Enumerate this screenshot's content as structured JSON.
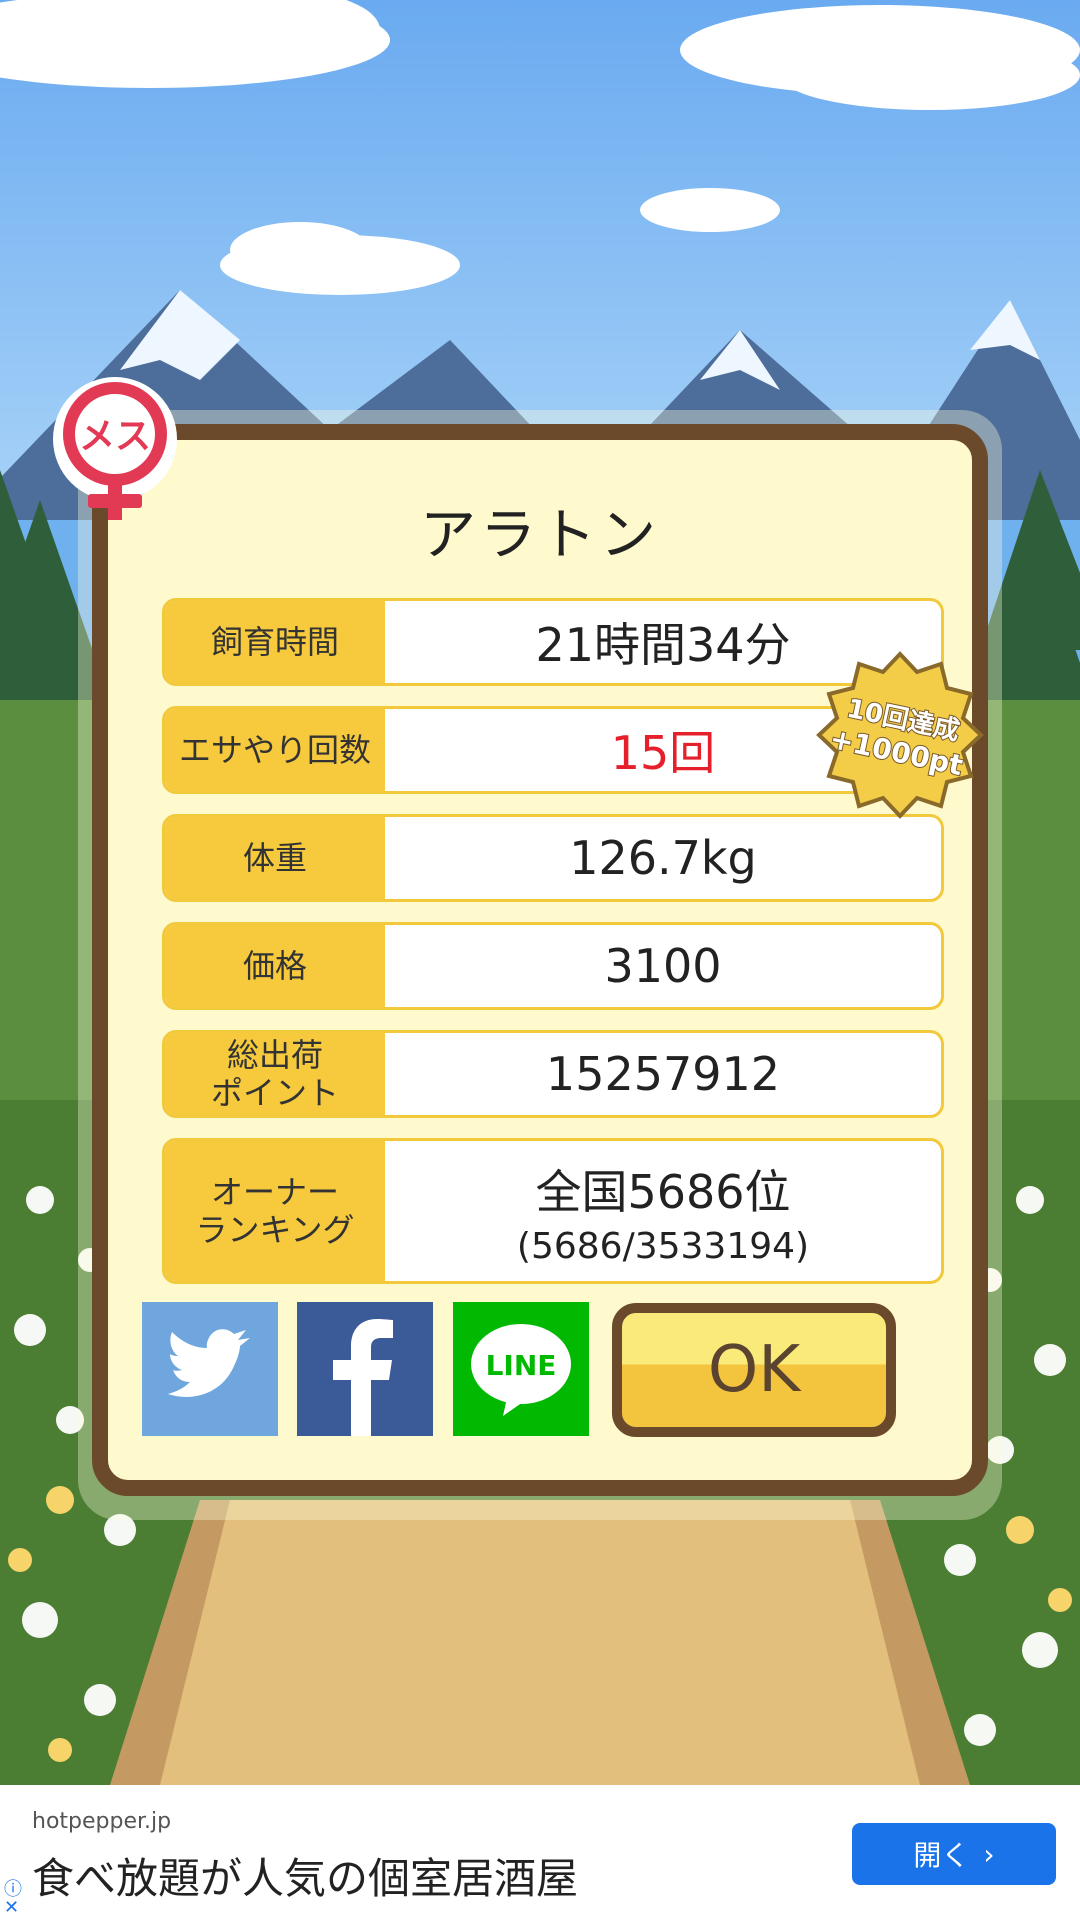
{
  "pet": {
    "gender_label": "メス",
    "name": "アラトン"
  },
  "stats": [
    {
      "label": "飼育時間",
      "value": "21時間34分"
    },
    {
      "label": "エサやり回数",
      "value": "15回"
    },
    {
      "label": "体重",
      "value": "126.7kg"
    },
    {
      "label": "価格",
      "value": "3100"
    },
    {
      "label": "総出荷\nポイント",
      "value": "15257912"
    },
    {
      "label": "オーナー\nランキング",
      "value": "全国5686位",
      "sub_value": "(5686/3533194)"
    }
  ],
  "badge": {
    "line1": "10回達成",
    "line2": "+1000pt"
  },
  "share": {
    "line_label": "LINE"
  },
  "ok_label": "OK",
  "ad": {
    "domain": "hotpepper.jp",
    "headline": "食べ放題が人気の個室居酒屋",
    "button_label": "開く",
    "info_icon": "ⓘ",
    "close_icon": "✕"
  },
  "colors": {
    "frame": "#6b4a2b",
    "panel": "#fffacd",
    "label_bg": "#f6ca3c",
    "highlight_red": "#e5202b",
    "twitter": "#6ea6dd",
    "facebook": "#3b5a98",
    "line": "#00b900",
    "ad_button": "#1a73e8"
  }
}
